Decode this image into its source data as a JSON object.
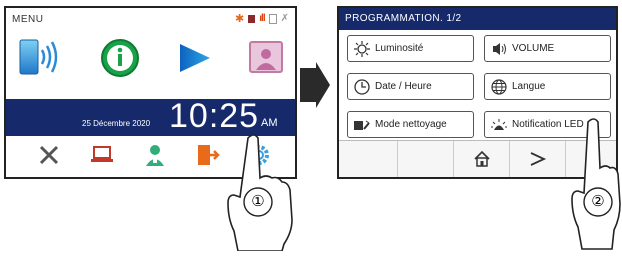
{
  "screen1": {
    "title": "MENU",
    "date": "25 Décembre 2020",
    "time": "10:25",
    "ampm": "AM",
    "step": "①"
  },
  "screen2": {
    "header": "PROGRAMMATION.  1/2",
    "buttons": {
      "luminosite": "Luminosité",
      "volume": "VOLUME",
      "date_heure": "Date / Heure",
      "langue": "Langue",
      "mode_nettoyage": "Mode nettoyage",
      "notification_led": "Notification LED"
    },
    "step": "②"
  },
  "colors": {
    "navy": "#15296b",
    "orange": "#e86a1a",
    "green": "#1aa24a",
    "blue": "#1f77c9"
  }
}
